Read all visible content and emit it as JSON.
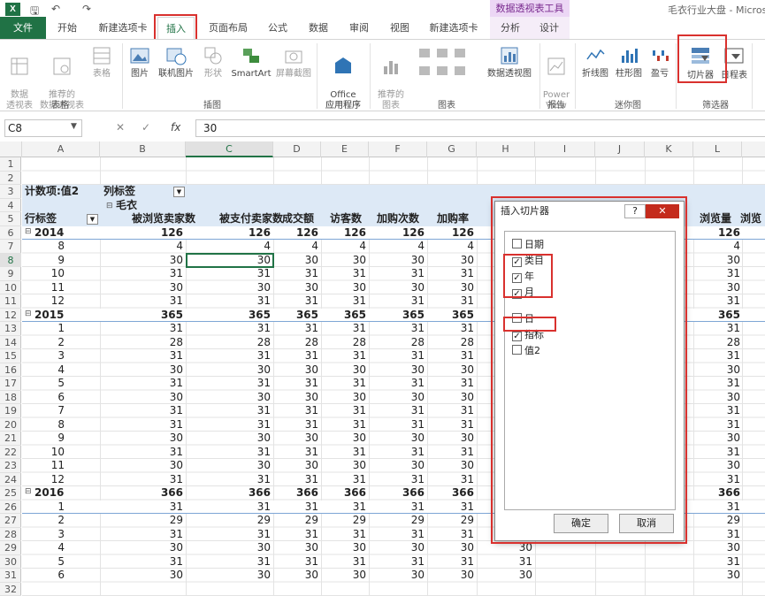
{
  "app": {
    "window_title": "毛衣行业大盘 - Micros",
    "logo": "X",
    "context_group": "数据透视表工具"
  },
  "tabs": [
    {
      "label": "文件"
    },
    {
      "label": "开始"
    },
    {
      "label": "新建选项卡"
    },
    {
      "label": "插入"
    },
    {
      "label": "页面布局"
    },
    {
      "label": "公式"
    },
    {
      "label": "数据"
    },
    {
      "label": "审阅"
    },
    {
      "label": "视图"
    },
    {
      "label": "新建选项卡"
    },
    {
      "label": "分析"
    },
    {
      "label": "设计"
    }
  ],
  "ribbon": {
    "btn": {
      "pivot": "数据\n透视表",
      "rec_pivot": "推荐的\n数据透视表",
      "table": "表格",
      "picture": "图片",
      "online_pic": "联机图片",
      "shapes": "形状",
      "smartart": "SmartArt",
      "screenshot": "屏幕截图",
      "office_apps": "Office\n应用程序",
      "rec_charts": "推荐的\n图表",
      "pivot_chart": "数据透视图",
      "power_view": "Power\nView",
      "line_spark": "折线图",
      "col_spark": "柱形图",
      "winloss_spark": "盈亏",
      "slicer": "切片器",
      "timeline": "日程表"
    },
    "groups": {
      "tables": "表格",
      "illustrations": "插图",
      "apps": "应用程序",
      "charts": "图表",
      "reports": "报告",
      "sparklines": "迷你图",
      "filters": "筛选器"
    }
  },
  "formula_bar": {
    "name_box": "C8",
    "cancel": "✕",
    "enter": "✓",
    "fx": "fx",
    "value": "30"
  },
  "columns": [
    "A",
    "B",
    "C",
    "D",
    "E",
    "F",
    "G",
    "H",
    "I",
    "J",
    "K",
    "L"
  ],
  "row_numbers": [
    "1",
    "2",
    "3",
    "4",
    "5",
    "6",
    "7",
    "8",
    "9",
    "10",
    "11",
    "12",
    "13",
    "14",
    "15",
    "16",
    "17",
    "18",
    "19",
    "20",
    "21",
    "22",
    "23",
    "24",
    "25",
    "26",
    "27",
    "28",
    "29",
    "30",
    "31",
    "32"
  ],
  "pivot": {
    "count_label": "计数项:值2",
    "col_label": "列标签",
    "category": "毛衣",
    "row_label": "行标签",
    "headers": [
      "被浏览卖家数",
      "被支付卖家数",
      "成交额",
      "访客数",
      "加购次数",
      "加购率",
      "加",
      "浏览量",
      "浏览"
    ],
    "rows": [
      {
        "label": "2014",
        "group": true,
        "v": [
          "126",
          "126",
          "126",
          "126",
          "126",
          "126",
          "",
          "126"
        ]
      },
      {
        "label": "8",
        "v": [
          "4",
          "4",
          "4",
          "4",
          "4",
          "4",
          "",
          "4"
        ]
      },
      {
        "label": "9",
        "v": [
          "30",
          "30",
          "30",
          "30",
          "30",
          "30",
          "",
          "30"
        ]
      },
      {
        "label": "10",
        "v": [
          "31",
          "31",
          "31",
          "31",
          "31",
          "31",
          "",
          "31"
        ]
      },
      {
        "label": "11",
        "v": [
          "30",
          "30",
          "30",
          "30",
          "30",
          "30",
          "",
          "30"
        ]
      },
      {
        "label": "12",
        "v": [
          "31",
          "31",
          "31",
          "31",
          "31",
          "31",
          "",
          "31"
        ]
      },
      {
        "label": "2015",
        "group": true,
        "v": [
          "365",
          "365",
          "365",
          "365",
          "365",
          "365",
          "",
          "365"
        ]
      },
      {
        "label": "1",
        "v": [
          "31",
          "31",
          "31",
          "31",
          "31",
          "31",
          "",
          "31"
        ]
      },
      {
        "label": "2",
        "v": [
          "28",
          "28",
          "28",
          "28",
          "28",
          "28",
          "",
          "28"
        ]
      },
      {
        "label": "3",
        "v": [
          "31",
          "31",
          "31",
          "31",
          "31",
          "31",
          "",
          "31"
        ]
      },
      {
        "label": "4",
        "v": [
          "30",
          "30",
          "30",
          "30",
          "30",
          "30",
          "",
          "30"
        ]
      },
      {
        "label": "5",
        "v": [
          "31",
          "31",
          "31",
          "31",
          "31",
          "31",
          "",
          "31"
        ]
      },
      {
        "label": "6",
        "v": [
          "30",
          "30",
          "30",
          "30",
          "30",
          "30",
          "",
          "30"
        ]
      },
      {
        "label": "7",
        "v": [
          "31",
          "31",
          "31",
          "31",
          "31",
          "31",
          "",
          "31"
        ]
      },
      {
        "label": "8",
        "v": [
          "31",
          "31",
          "31",
          "31",
          "31",
          "31",
          "",
          "31"
        ]
      },
      {
        "label": "9",
        "v": [
          "30",
          "30",
          "30",
          "30",
          "30",
          "30",
          "",
          "30"
        ]
      },
      {
        "label": "10",
        "v": [
          "31",
          "31",
          "31",
          "31",
          "31",
          "31",
          "",
          "31"
        ]
      },
      {
        "label": "11",
        "v": [
          "30",
          "30",
          "30",
          "30",
          "30",
          "30",
          "",
          "30"
        ]
      },
      {
        "label": "12",
        "v": [
          "31",
          "31",
          "31",
          "31",
          "31",
          "31",
          "",
          "31"
        ]
      },
      {
        "label": "2016",
        "group": true,
        "v": [
          "366",
          "366",
          "366",
          "366",
          "366",
          "366",
          "",
          "366"
        ]
      },
      {
        "label": "1",
        "v": [
          "31",
          "31",
          "31",
          "31",
          "31",
          "31",
          "",
          "31"
        ]
      },
      {
        "label": "2",
        "v": [
          "29",
          "29",
          "29",
          "29",
          "29",
          "29",
          "",
          "29"
        ]
      },
      {
        "label": "3",
        "v": [
          "31",
          "31",
          "31",
          "31",
          "31",
          "31",
          "",
          "31"
        ]
      },
      {
        "label": "4",
        "v": [
          "30",
          "30",
          "30",
          "30",
          "30",
          "30",
          "30",
          "30"
        ]
      },
      {
        "label": "5",
        "v": [
          "31",
          "31",
          "31",
          "31",
          "31",
          "31",
          "31",
          "31"
        ]
      },
      {
        "label": "6",
        "v": [
          "30",
          "30",
          "30",
          "30",
          "30",
          "30",
          "30",
          "30"
        ]
      }
    ]
  },
  "dialog": {
    "title": "插入切片器",
    "help": "?",
    "close": "✕",
    "fields": [
      {
        "label": "日期",
        "checked": false
      },
      {
        "label": "类目",
        "checked": true
      },
      {
        "label": "年",
        "checked": true
      },
      {
        "label": "月",
        "checked": true
      },
      {
        "label": "日",
        "checked": false
      },
      {
        "label": "指标",
        "checked": true
      },
      {
        "label": "值2",
        "checked": false
      }
    ],
    "check_mark": "✓",
    "ok": "确定",
    "cancel": "取消"
  },
  "colors": {
    "excel_green": "#217346",
    "highlight_red": "#d9312e",
    "pivot_band": "#dde9f6",
    "context_tab": "#ecd7f5"
  }
}
